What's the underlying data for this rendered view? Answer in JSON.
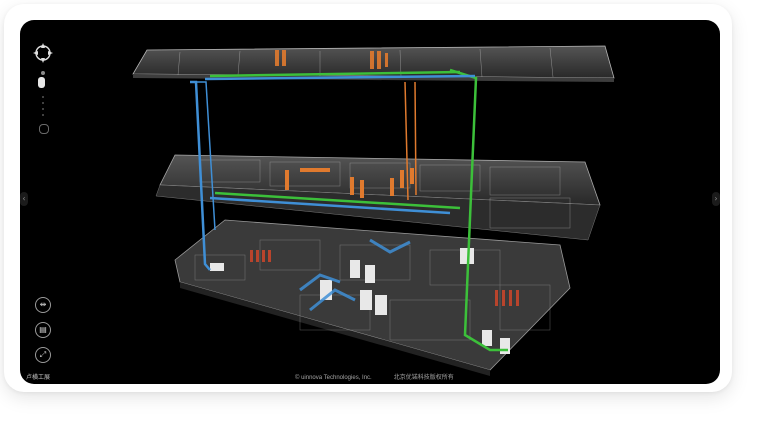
{
  "toolbar": {
    "compass_icon": "compass-icon",
    "zoom_in_icon": "plus-icon",
    "zoom_out_icon": "minus-icon",
    "buttons": [
      {
        "name": "split-view-button",
        "icon": "split-icon",
        "glyph": "⇹"
      },
      {
        "name": "floor-button",
        "icon": "layers-icon",
        "glyph": "▤"
      },
      {
        "name": "fullscreen-button",
        "icon": "expand-icon",
        "glyph": "⤢"
      }
    ]
  },
  "footer": {
    "left_label": "卢横工展",
    "copyright": "© uinnova Technologies, Inc.",
    "copyright_cn": "北京优锘科技版权所有"
  },
  "colors": {
    "pipe_blue": "#3f8fd6",
    "pipe_green": "#3cc03a",
    "pipe_orange": "#e07a2e",
    "floor_glass": "#8d8d8d"
  }
}
